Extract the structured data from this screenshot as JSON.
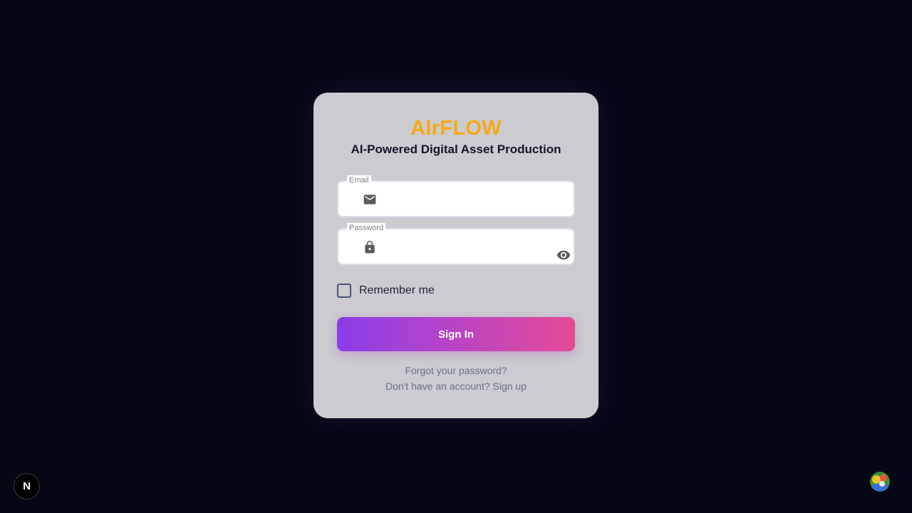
{
  "brand": {
    "title": "AIrFLOW",
    "subtitle": "AI-Powered Digital Asset Production",
    "accent": "#f6a916"
  },
  "form": {
    "email": {
      "label": "Email",
      "value": "",
      "icon": "mail-icon"
    },
    "password": {
      "label": "Password",
      "value": "",
      "icon": "lock-icon",
      "toggle_icon": "eye-icon"
    },
    "remember_label": "Remember me",
    "submit_label": "Sign In",
    "forgot_label": "Forgot your password?",
    "signup_label": "Don't have an account? Sign up"
  },
  "overlay": {
    "nextjs_badge": "N",
    "avatar_icon": "avatar-icon"
  },
  "colors": {
    "background": "#050714",
    "card": "#cbcbd0",
    "button_from": "#8a3ee8",
    "button_to": "#e54a96"
  }
}
